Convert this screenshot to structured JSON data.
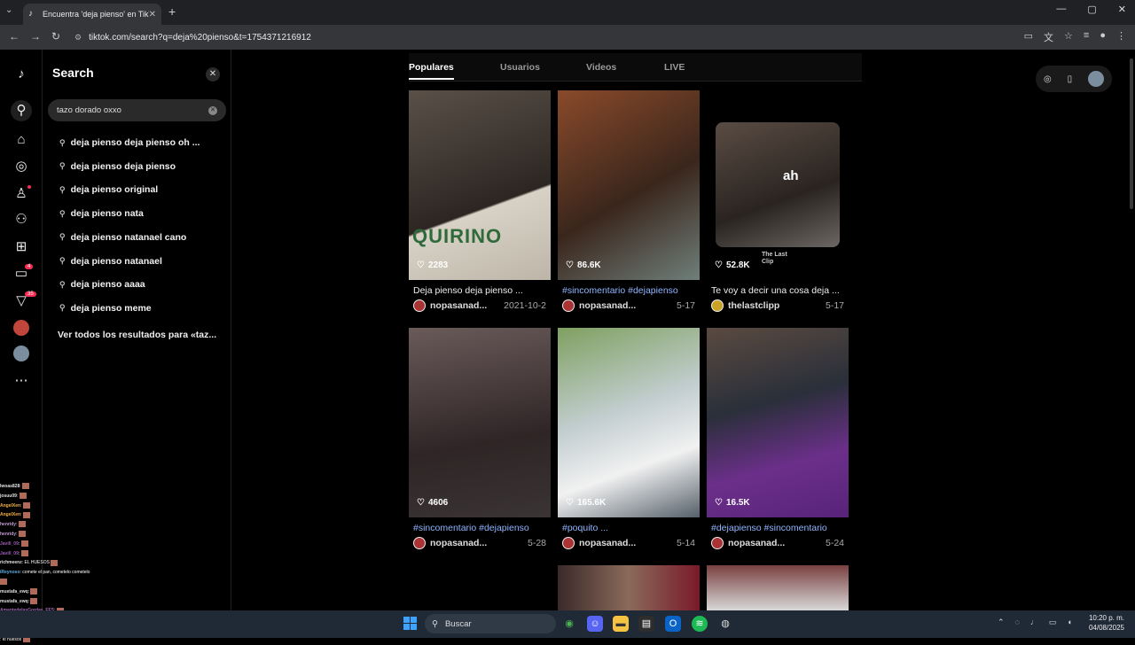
{
  "browser": {
    "tab_title": "Encuentra 'deja pienso' en TikTok",
    "url": "tiktok.com/search?q=deja%20pienso&t=1754371216912"
  },
  "panel": {
    "title": "Search",
    "search_value": "tazo dorado oxxo",
    "suggestions": [
      "deja pienso deja pienso oh ...",
      "deja pienso deja pienso",
      "deja pienso original",
      "deja pienso nata",
      "deja pienso natanael cano",
      "deja pienso natanael",
      "deja pienso aaaa",
      "deja pienso meme"
    ],
    "view_all": "Ver todos los resultados para «taz..."
  },
  "rail": {
    "inbox_badge": "4",
    "activity_badge": "35"
  },
  "search_tabs": [
    "Populares",
    "Usuarios",
    "Videos",
    "LIVE"
  ],
  "videos": [
    {
      "likes": "2283",
      "caption": "Deja pienso deja pienso ...",
      "author": "nopasanad...",
      "date": "2021-10-2",
      "overlay": "QUIRINO"
    },
    {
      "likes": "86.6K",
      "caption": "#sincomentario #dejapienso",
      "author": "nopasanad...",
      "date": "5-17"
    },
    {
      "likes": "52.8K",
      "caption": "Te voy a decir una cosa deja ...",
      "author": "thelastclipp",
      "date": "5-17",
      "overlay": "ah",
      "watermark": "The Last Clip"
    },
    {
      "likes": "4606",
      "caption": "#sincomentario #dejapienso",
      "author": "nopasanad...",
      "date": "5-28"
    },
    {
      "likes": "165.6K",
      "caption": "#poquito ...",
      "author": "nopasanad...",
      "date": "5-14"
    },
    {
      "likes": "16.5K",
      "caption": "#dejapienso #sincomentario",
      "author": "nopasanad...",
      "date": "5-24"
    }
  ],
  "chat": [
    {
      "user": "lwoas828",
      "msg": ":",
      "color": "#e0e0e0"
    },
    {
      "user": "josuu09",
      "msg": ":",
      "color": "#e0e0e0"
    },
    {
      "user": "AngelXen",
      "msg": ":",
      "color": "#f5b041"
    },
    {
      "user": "AngelXen",
      "msg": ":",
      "color": "#f5b041"
    },
    {
      "user": "henridy",
      "msg": ":",
      "color": "#c39bd3"
    },
    {
      "user": "henridy",
      "msg": ":",
      "color": "#c39bd3"
    },
    {
      "user": "Javill_09",
      "msg": ":",
      "color": "#9b59b6"
    },
    {
      "user": "Javill_09",
      "msg": ":",
      "color": "#9b59b6"
    },
    {
      "user": "richmeenz",
      "msg": ": EL HUESOS",
      "color": "#e0e0e0"
    },
    {
      "user": "iReynoso",
      "msg": ": comete el pan, cometelo cometelo",
      "color": "#5dade2"
    },
    {
      "user": "mustafa_ewq",
      "msg": ":",
      "color": "#e0e0e0"
    },
    {
      "user": "mustafa_ewq",
      "msg": ":",
      "color": "#e0e0e0"
    },
    {
      "user": "AmantedelasGordas_FES",
      "msg": ":",
      "color": "#a569bd"
    },
    {
      "user": "AmantedelasGordas_FES",
      "msg": ":",
      "color": "#a569bd"
    },
    {
      "user": "AmantedelasGordas_FES",
      "msg": ":",
      "color": "#a569bd"
    },
    {
      "user": "",
      "msg": ": el huesos",
      "color": "#e74c3c"
    }
  ],
  "taskbar": {
    "search_label": "Buscar",
    "time": "10:20 p. m.",
    "date": "04/08/2025"
  },
  "colors": {
    "accent": "#fe2c55",
    "hashtag": "#8eb5ff",
    "panel_bg": "#000000"
  }
}
